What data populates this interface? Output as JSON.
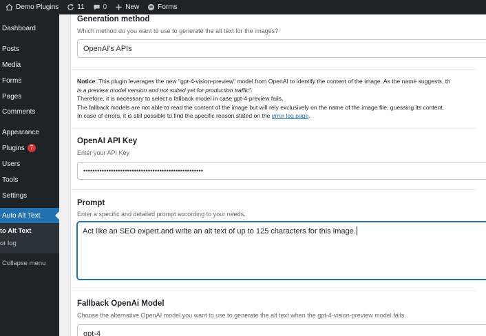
{
  "admin_bar": {
    "site_name": "Demo Plugins",
    "updates_count": "11",
    "comments_count": "0",
    "new_label": "New",
    "forms_label": "Forms"
  },
  "sidebar": {
    "items": [
      {
        "label": "Dashboard"
      },
      {
        "label": "Posts"
      },
      {
        "label": "Media"
      },
      {
        "label": "Forms"
      },
      {
        "label": "Pages"
      },
      {
        "label": "Comments"
      },
      {
        "label": "Appearance"
      },
      {
        "label": "Plugins",
        "badge": "7"
      },
      {
        "label": "Users"
      },
      {
        "label": "Tools"
      },
      {
        "label": "Settings"
      },
      {
        "label": "Auto Alt Text"
      }
    ],
    "submenu": [
      {
        "label": "to Alt Text"
      },
      {
        "label": "or log"
      }
    ],
    "collapse_label": "Collapse menu"
  },
  "generation": {
    "title": "Generation method",
    "description": "Which method do you want to use to generate the alt text for the images?",
    "value": "OpenAI's APIs"
  },
  "notice": {
    "label": "Notice",
    "line1": ": This plugin leverages the new \"gpt-4-vision-preview\" model from OpenAI to identify the content of the image. As the name suggests, th",
    "line2": "is a preview model version and not suited yet for production traffic\".",
    "line3": "Therefore, it is necessary to select a fallback model in case gpt-4-preview fails.",
    "line4": "The fallback models are not able to read the content of the image but will rely exclusively on the name of the image file, guessing its content.",
    "line5": "In case of errors, it is still possible to find the specific reason stated on the ",
    "link": "error log page",
    "line5_end": "."
  },
  "api_key": {
    "title": "OpenAI API Key",
    "description": "Enter your API Key",
    "value": "••••••••••••••••••••••••••••••••••••••••••••••••••••"
  },
  "prompt": {
    "title": "Prompt",
    "description": "Enter a specific and detailed prompt according to your needs.",
    "value": "Act like an SEO expert and write an alt text of up to 125 characters for this image."
  },
  "fallback": {
    "title": "Fallback OpenAi Model",
    "description": "Choose the alternative OpenAI model you want to use to generate the alt text when the gpt-4-vision-preview model fails.",
    "value": "gpt-4"
  },
  "colors": {
    "admin_dark": "#1d2327",
    "accent_blue": "#2271b1",
    "badge_red": "#d63638"
  }
}
